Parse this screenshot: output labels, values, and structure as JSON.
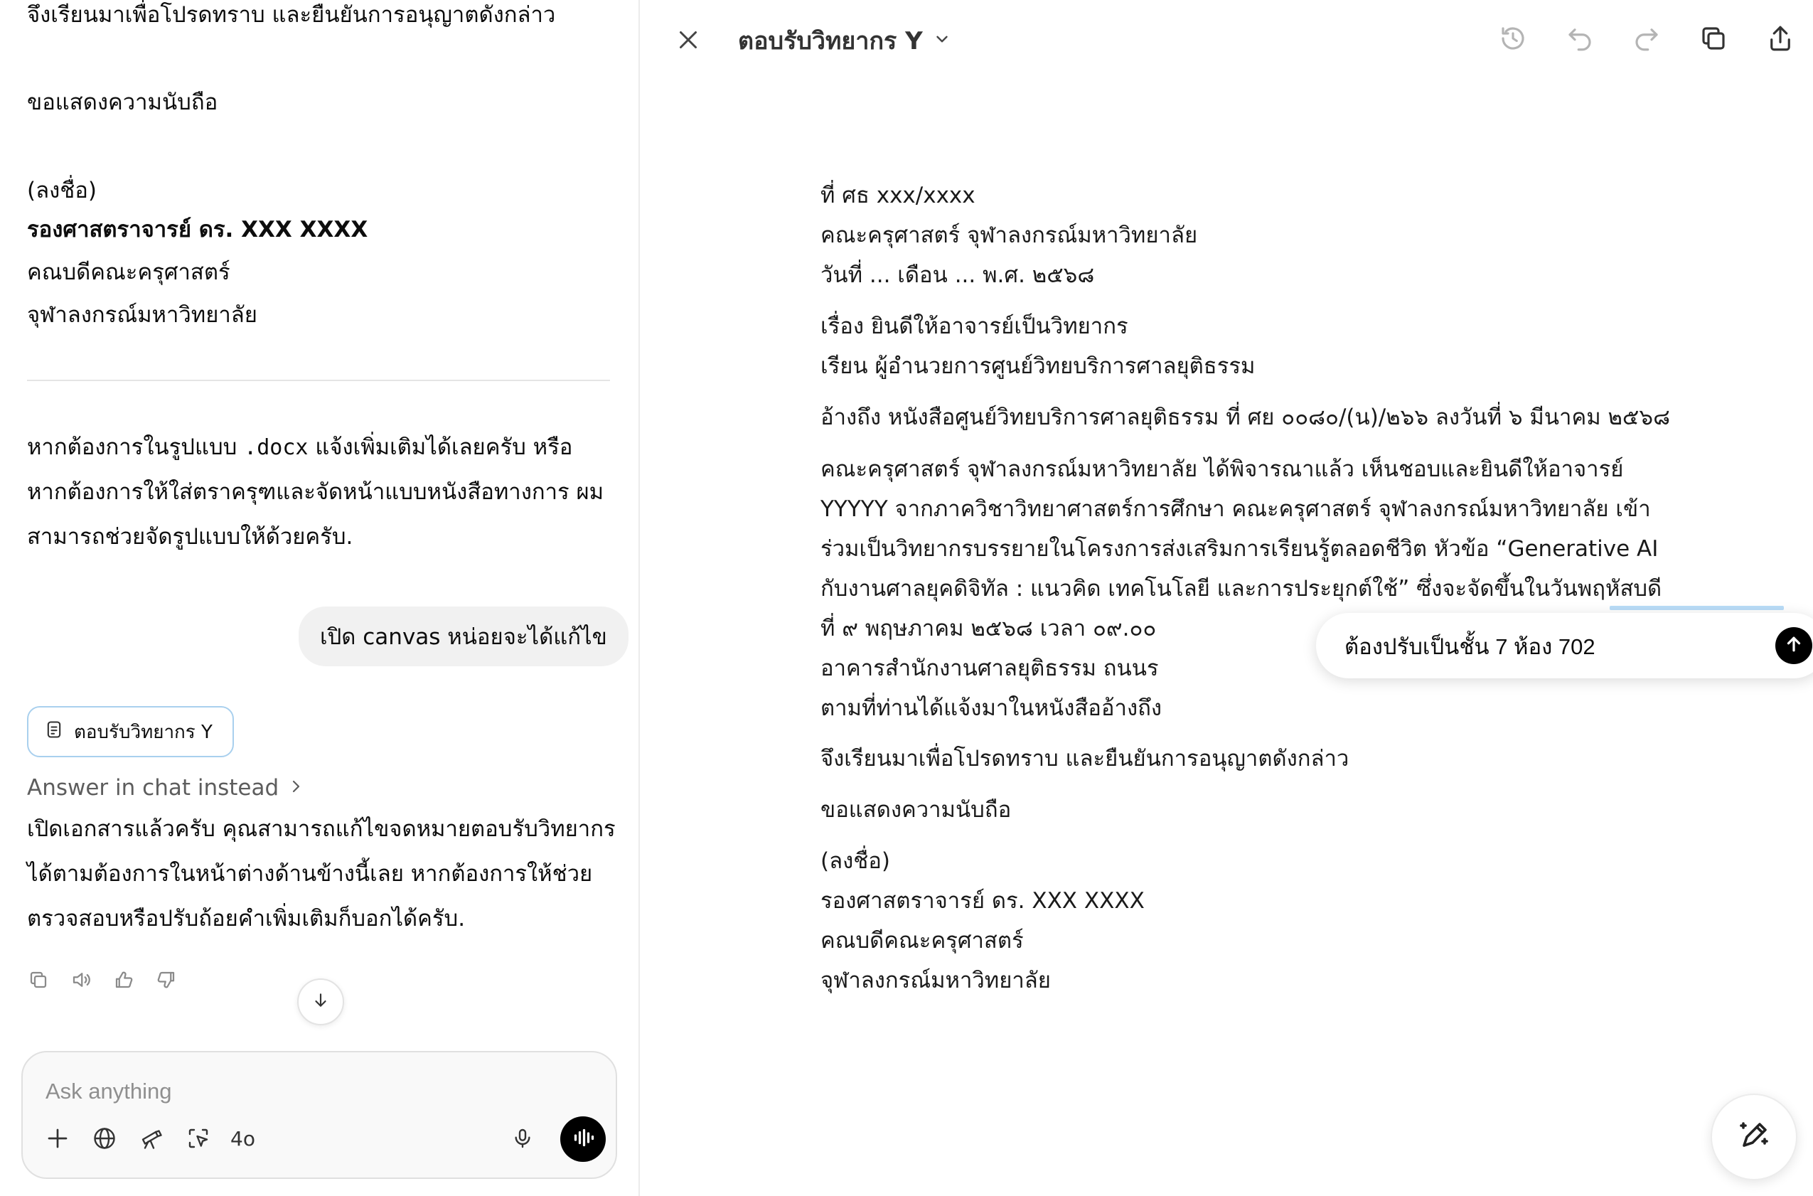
{
  "chat": {
    "prev_letter": {
      "closing_line": "จึงเรียนมาเพื่อโปรดทราบ และยืนยันการอนุญาตดังกล่าว",
      "regards": "ขอแสดงความนับถือ",
      "signature_label": "(ลงชื่อ)",
      "signer_name": "รองศาสตราจารย์ ดร. XXX XXXX",
      "signer_title": "คณบดีคณะครุศาสตร์",
      "signer_org": "จุฬาลงกรณ์มหาวิทยาลัย"
    },
    "assistant_msg_1": {
      "line1_pre": "หากต้องการในรูปแบบ ",
      "line1_code": ".docx",
      "line1_post": " แจ้งเพิ่มเติมได้เลยครับ หรือ",
      "line2": "หากต้องการให้ใส่ตราครุฑและจัดหน้าแบบหนังสือทางการ ผม",
      "line3": "สามารถช่วยจัดรูปแบบให้ด้วยครับ."
    },
    "user_msg": "เปิด canvas หน่อยจะได้แก้ไข",
    "doc_chip_label": "ตอบรับวิทยากร Y",
    "answer_in_chat": "Answer in chat instead",
    "assistant_msg_2": {
      "line1": "เปิดเอกสารแล้วครับ คุณสามารถแก้ไขจดหมายตอบรับวิทยากร",
      "line2": "ได้ตามต้องการในหน้าต่างด้านข้างนี้เลย หากต้องการให้ช่วย",
      "line3": "ตรวจสอบหรือปรับถ้อยคำเพิ่มเติมก็บอกได้ครับ."
    },
    "message_actions": [
      "copy-icon",
      "read-aloud-icon",
      "thumbs-up-icon",
      "thumbs-down-icon"
    ],
    "composer": {
      "placeholder": "Ask anything",
      "model": "4o",
      "tools": [
        "plus-icon",
        "globe-icon",
        "telescope-icon",
        "select-area-icon"
      ]
    }
  },
  "canvas": {
    "title": "ตอบรับวิทยากร Y",
    "header_icons": [
      "history-icon",
      "undo-icon",
      "redo-icon",
      "copy-icon",
      "share-icon"
    ],
    "document": {
      "ref_no": "ที่ ศธ xxx/xxxx",
      "org": "คณะครุศาสตร์ จุฬาลงกรณ์มหาวิทยาลัย",
      "date": "วันที่ ... เดือน ... พ.ศ. ๒๕๖๘",
      "subject": "เรื่อง ยินดีให้อาจารย์เป็นวิทยากร",
      "to": "เรียน ผู้อำนวยการศูนย์วิทยบริการศาลยุติธรรม",
      "reference": "อ้างถึง หนังสือศูนย์วิทยบริการศาลยุติธรรม ที่ ศย ๐๐๘๐/(น)/๒๖๖ ลงวันที่ ๖ มีนาคม ๒๕๖๘",
      "body_lines": [
        "คณะครุศาสตร์ จุฬาลงกรณ์มหาวิทยาลัย ได้พิจารณาแล้ว เห็นชอบและยินดีให้อาจารย์",
        "YYYYY จากภาควิชาวิทยาศาสตร์การศึกษา คณะครุศาสตร์ จุฬาลงกรณ์มหาวิทยาลัย เข้า",
        "ร่วมเป็นวิทยากรบรรยายในโครงการส่งเสริมการเรียนรู้ตลอดชีวิต หัวข้อ “Generative AI",
        "กับงานศาลยุคดิจิทัล : แนวคิด เทคโนโลยี และการประยุกต์ใช้” ซึ่งจะจัดขึ้นในวันพฤหัสบดี",
        "ที่ ๙ พฤษภาคม ๒๕๖๘ เวลา ๐๙.๐๐",
        "อาคารสำนักงานศาลยุติธรรม ถนนร",
        "ตามที่ท่านได้แจ้งมาในหนังสืออ้างถึง"
      ],
      "closing": "จึงเรียนมาเพื่อโปรดทราบ และยืนยันการอนุญาตดังกล่าว",
      "regards": "ขอแสดงความนับถือ",
      "signature_label": "(ลงชื่อ)",
      "signer_name": "รองศาสตราจารย์ ดร. XXX XXXX",
      "signer_title": "คณบดีคณะครุศาสตร์",
      "signer_org": "จุฬาลงกรณ์มหาวิทยาลัย"
    },
    "edit_popover": {
      "value": "ต้องปรับเป็นชั้น 7 ห้อง 702"
    }
  }
}
